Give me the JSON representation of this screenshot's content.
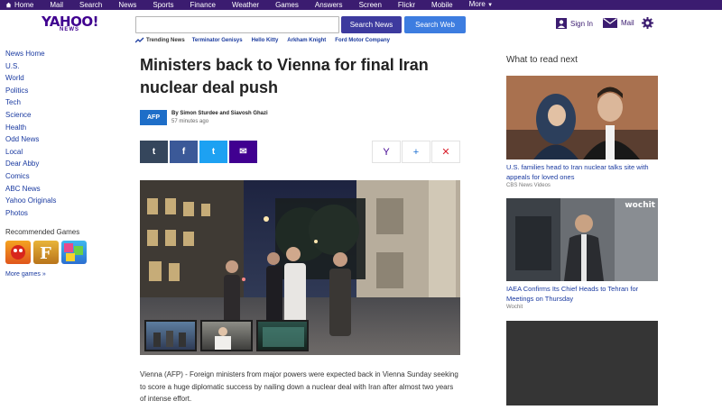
{
  "topbar": {
    "items": [
      "Home",
      "Mail",
      "Search",
      "News",
      "Sports",
      "Finance",
      "Weather",
      "Games",
      "Answers",
      "Screen",
      "Flickr",
      "Mobile",
      "More"
    ]
  },
  "header": {
    "logo": "YAHOO!",
    "logo_sub": "NEWS",
    "search_news_label": "Search News",
    "search_web_label": "Search Web",
    "signin_label": "Sign In",
    "mail_label": "Mail"
  },
  "trending": {
    "label": "Trending News",
    "links": [
      "Terminator Genisys",
      "Hello Kitty",
      "Arkham Knight",
      "Ford Motor Company"
    ]
  },
  "leftnav": {
    "items": [
      "News Home",
      "U.S.",
      "World",
      "Politics",
      "Tech",
      "Science",
      "Health",
      "Odd News",
      "Local",
      "Dear Abby",
      "Comics",
      "ABC News",
      "Yahoo Originals",
      "Photos"
    ]
  },
  "games": {
    "title": "Recommended Games",
    "more": "More games »"
  },
  "article": {
    "headline": "Ministers back to Vienna for final Iran nuclear deal push",
    "source_logo": "AFP",
    "authors": "By Simon Sturdee and Siavosh Ghazi",
    "time": "57 minutes ago",
    "body": "Vienna (AFP) - Foreign ministers from major powers were expected back in Vienna Sunday seeking to score a huge diplomatic success by nailing down a nuclear deal with Iran after almost two years of intense effort."
  },
  "share": {
    "tumblr": "t",
    "facebook": "f",
    "twitter": "t",
    "email": "✉",
    "yahoo": "Y",
    "add": "+",
    "close": "✕"
  },
  "rail": {
    "title": "What to read next",
    "cards": [
      {
        "headline": "U.S. families head to Iran nuclear talks site with appeals for loved ones",
        "source": "CBS News Videos"
      },
      {
        "headline": "IAEA Confirms Its Chief Heads to Tehran for Meetings on Thursday",
        "source": "Wochit",
        "badge": "wochit"
      }
    ]
  },
  "colors": {
    "topbar": "#3b1c70",
    "brand": "#400090",
    "link": "#1a3aa0",
    "tumblr": "#35465c",
    "facebook": "#3b5998",
    "twitter": "#1da1f2",
    "email": "#400090"
  }
}
